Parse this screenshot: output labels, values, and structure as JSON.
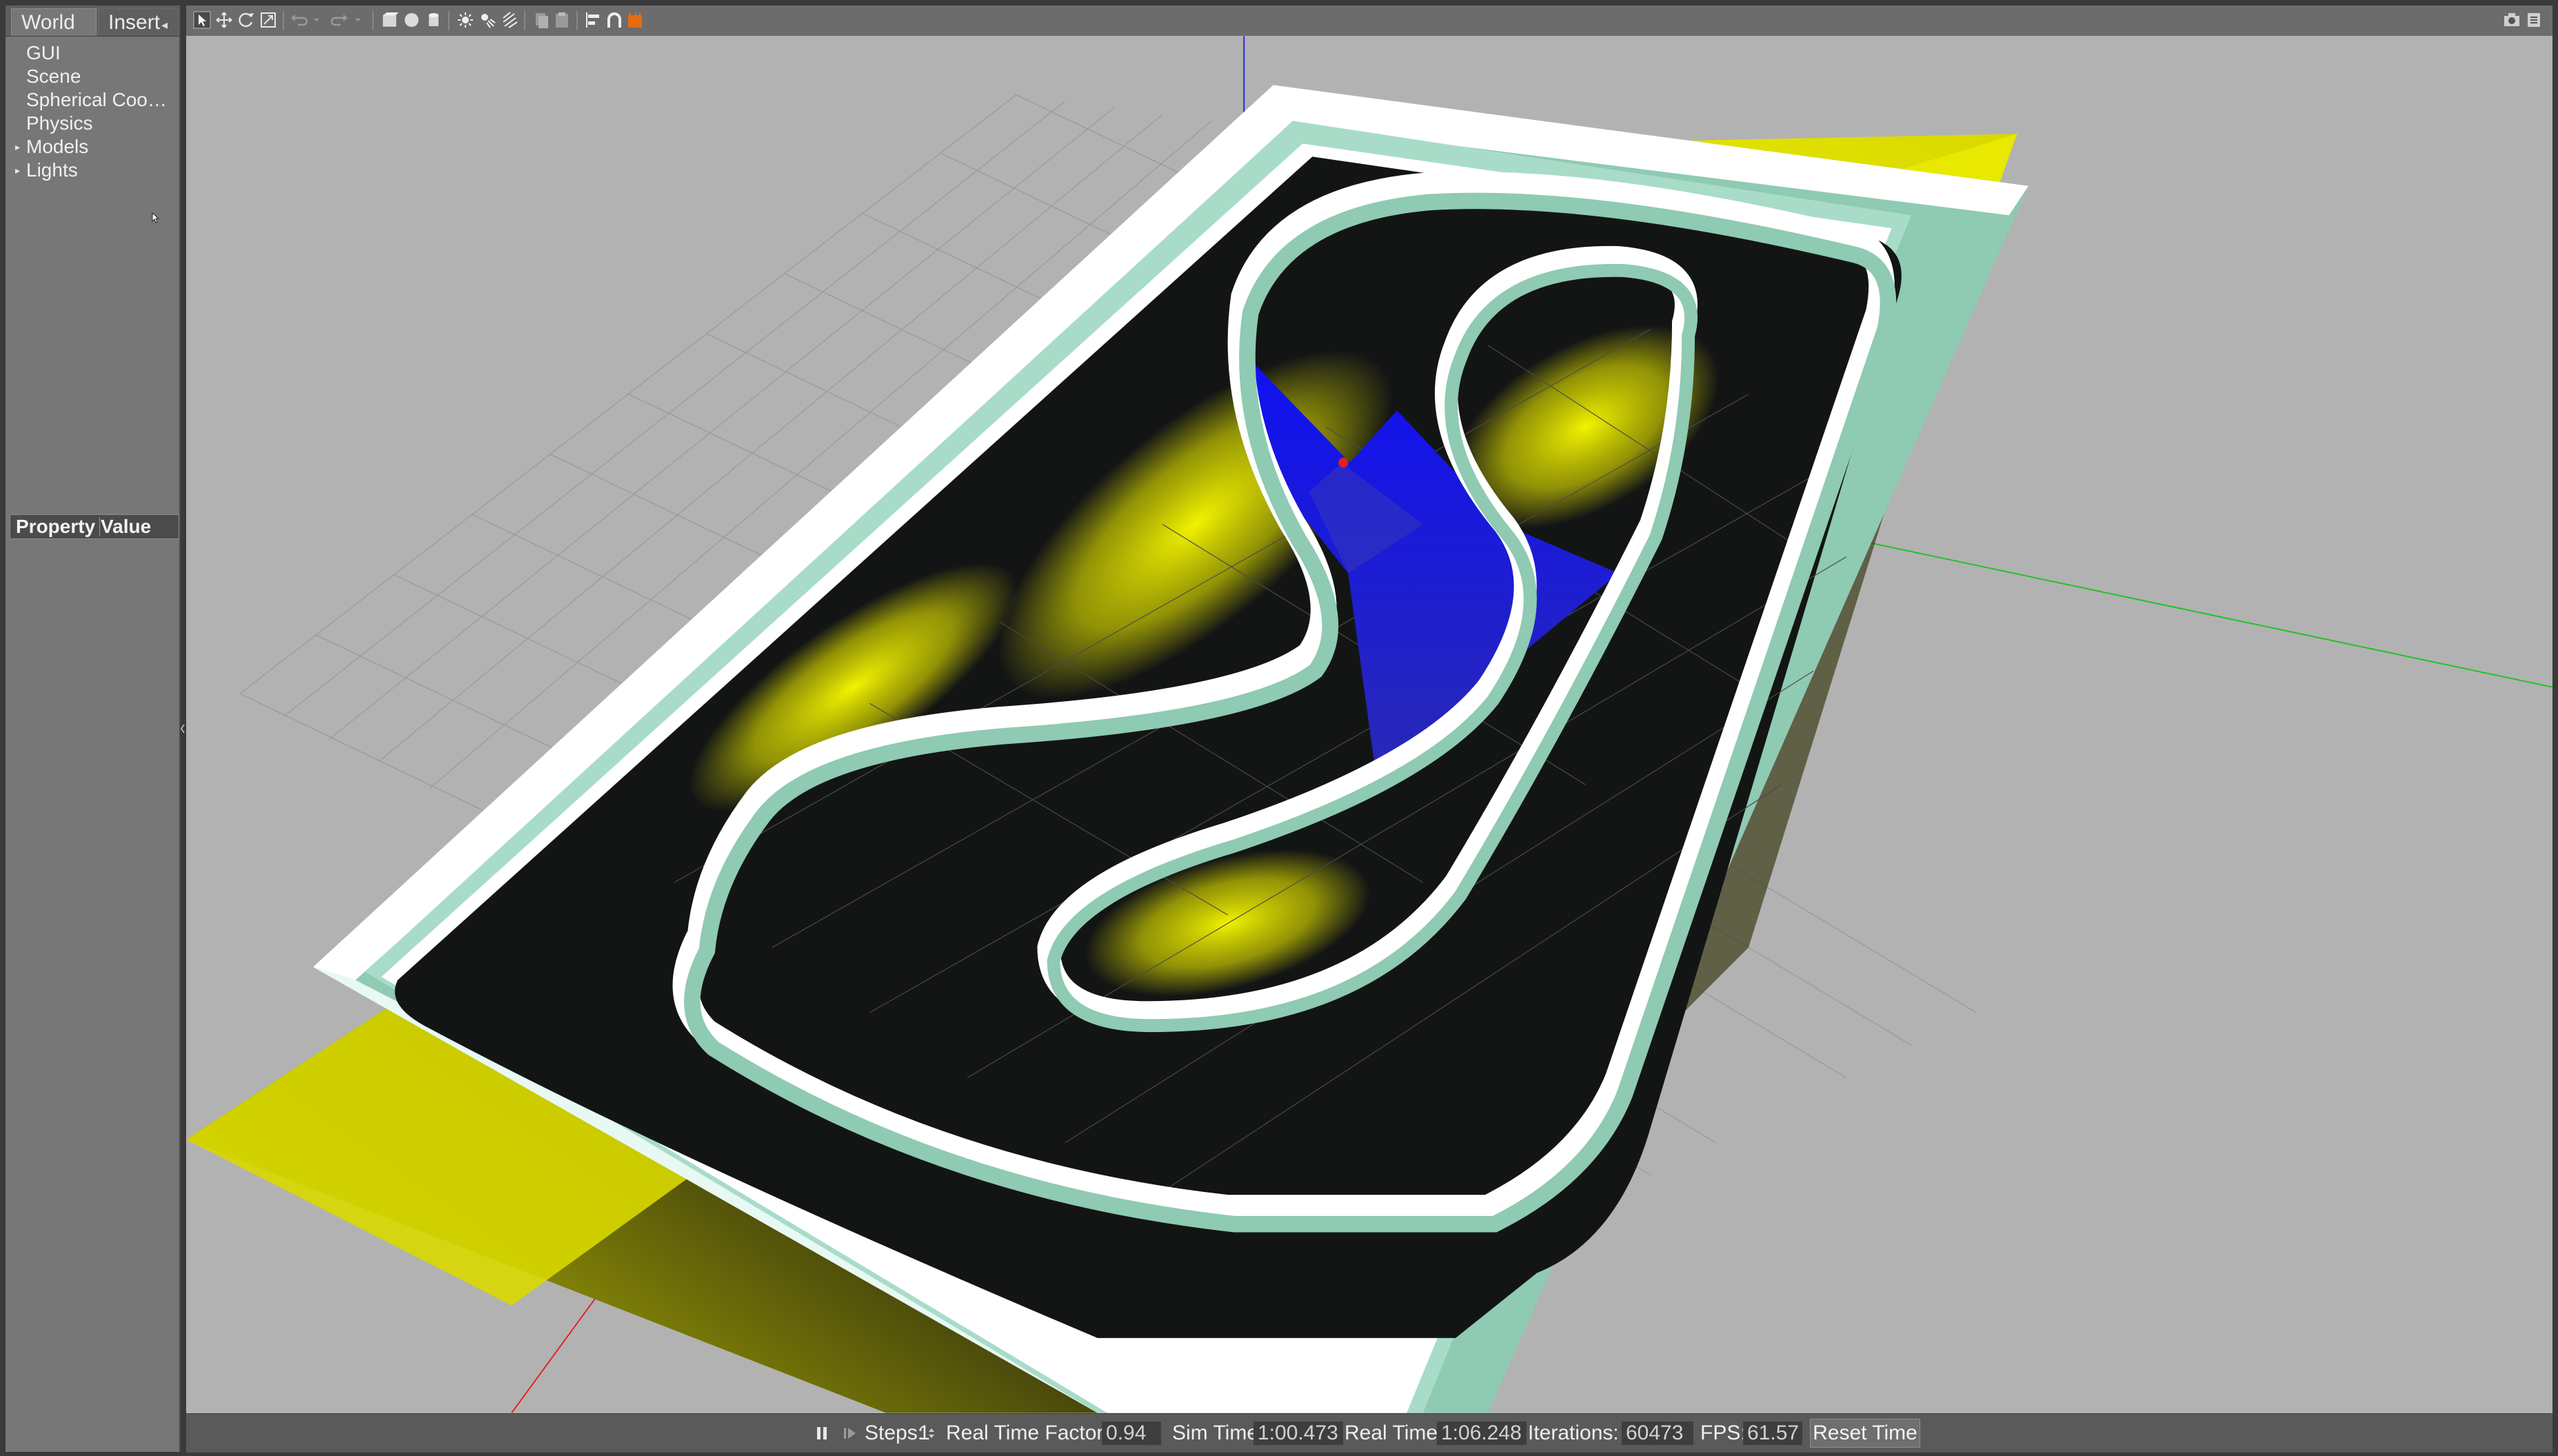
{
  "tabs": {
    "world": "World",
    "insert": "Insert"
  },
  "tree": {
    "items": [
      {
        "label": "GUI",
        "expandable": false
      },
      {
        "label": "Scene",
        "expandable": false
      },
      {
        "label": "Spherical Coo…",
        "expandable": false
      },
      {
        "label": "Physics",
        "expandable": false
      },
      {
        "label": "Models",
        "expandable": true
      },
      {
        "label": "Lights",
        "expandable": true
      }
    ]
  },
  "properties": {
    "col_property": "Property",
    "col_value": "Value"
  },
  "toolbar": {
    "icons": [
      "select-icon",
      "translate-icon",
      "rotate-icon",
      "scale-icon",
      "undo-icon",
      "redo-icon",
      "box-icon",
      "sphere-icon",
      "cylinder-icon",
      "point-light-icon",
      "spot-light-icon",
      "directional-light-icon",
      "copy-icon",
      "paste-icon",
      "align-icon",
      "snap-icon",
      "view-angle-icon",
      "screenshot-icon",
      "record-icon"
    ]
  },
  "status": {
    "steps_label": "Steps:",
    "steps_value": "1",
    "rtf_label": "Real Time Factor:",
    "rtf_value": "0.94",
    "sim_time_label": "Sim Time:",
    "sim_time_value": "1:00.473",
    "real_time_label": "Real Time:",
    "real_time_value": "1:06.248",
    "iterations_label": "Iterations:",
    "iterations_value": "60473",
    "fps_label": "FPS:",
    "fps_value": "61.57",
    "reset_label": "Reset Time"
  },
  "colors": {
    "panel": "#777777",
    "viewport_bg": "#b2b2b2",
    "track_surface": "#131515",
    "wall": "#8fcab3",
    "wall_top": "#ffffff",
    "ground_yellow": "#e6e600",
    "origin_blue": "#1414e8",
    "axis_x": "#e02020",
    "axis_y": "#20c020",
    "axis_z": "#2020e0"
  }
}
